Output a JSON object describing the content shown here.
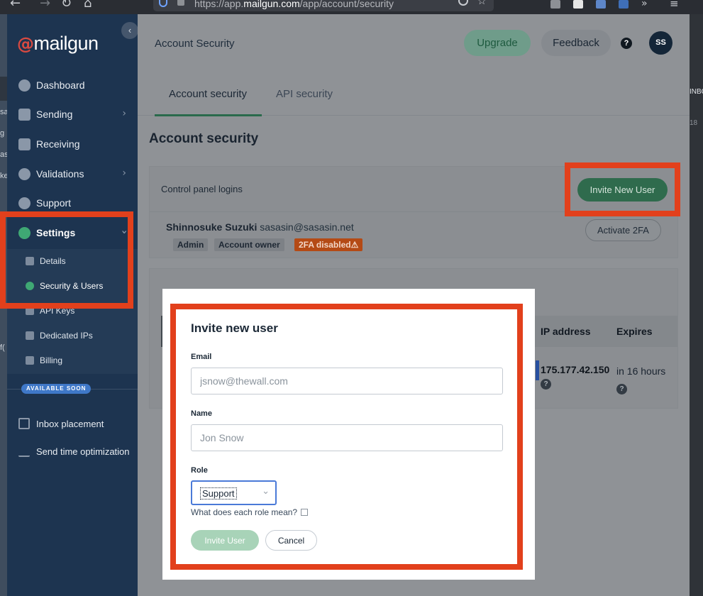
{
  "browser": {
    "url_prefix": "https://app.",
    "url_domain": "mailgun.com",
    "url_path": "/app/account/security",
    "dots": "•••"
  },
  "desktop": {
    "right_text_top": "INBO",
    "right_text_num": "18",
    "left_fragments": [
      "sa",
      "g",
      "as",
      "ke",
      "f("
    ]
  },
  "sidebar": {
    "logo_text": "mailgun",
    "items": [
      {
        "label": "Dashboard",
        "icon": "dashboard-icon"
      },
      {
        "label": "Sending",
        "icon": "send-icon"
      },
      {
        "label": "Receiving",
        "icon": "inbox-icon"
      },
      {
        "label": "Validations",
        "icon": "validations-icon"
      },
      {
        "label": "Support",
        "icon": "support-icon"
      },
      {
        "label": "Settings",
        "icon": "gear-icon"
      }
    ],
    "sub_items": [
      {
        "label": "Details"
      },
      {
        "label": "Security & Users"
      },
      {
        "label": "API Keys"
      },
      {
        "label": "Dedicated IPs"
      },
      {
        "label": "Billing"
      }
    ],
    "available_soon": "AVAILABLE SOON",
    "bottom_items": [
      {
        "label": "Inbox placement"
      },
      {
        "label": "Send time optimization"
      }
    ]
  },
  "header": {
    "crumb": "Account Security",
    "upgrade": "Upgrade",
    "feedback": "Feedback",
    "help": "?",
    "avatar": "SS"
  },
  "tabs": [
    {
      "label": "Account security"
    },
    {
      "label": "API security"
    }
  ],
  "page": {
    "title": "Account security",
    "control_panel_label": "Control panel logins",
    "invite_new_user": "Invite New User",
    "user": {
      "name": "Shinnosuke Suzuki",
      "email": "sasasin@sasasin.net",
      "badges": [
        "Admin",
        "Account owner",
        "2FA disabled⚠"
      ]
    },
    "activate_2fa": "Activate 2FA",
    "sessions": {
      "col_ip": "IP address",
      "col_expires": "Expires",
      "ip": "175.177.42.150",
      "expires": "in 16 hours"
    }
  },
  "modal": {
    "title": "Invite new user",
    "email_label": "Email",
    "email_placeholder": "jsnow@thewall.com",
    "name_label": "Name",
    "name_placeholder": "Jon Snow",
    "role_label": "Role",
    "role_value": "Support",
    "role_help": "What does each role mean?",
    "invite_button": "Invite User",
    "cancel_button": "Cancel"
  },
  "colors": {
    "highlight": "#e2401c",
    "brand_green": "#2f6b4d",
    "sidebar_bg": "#1d3450"
  }
}
